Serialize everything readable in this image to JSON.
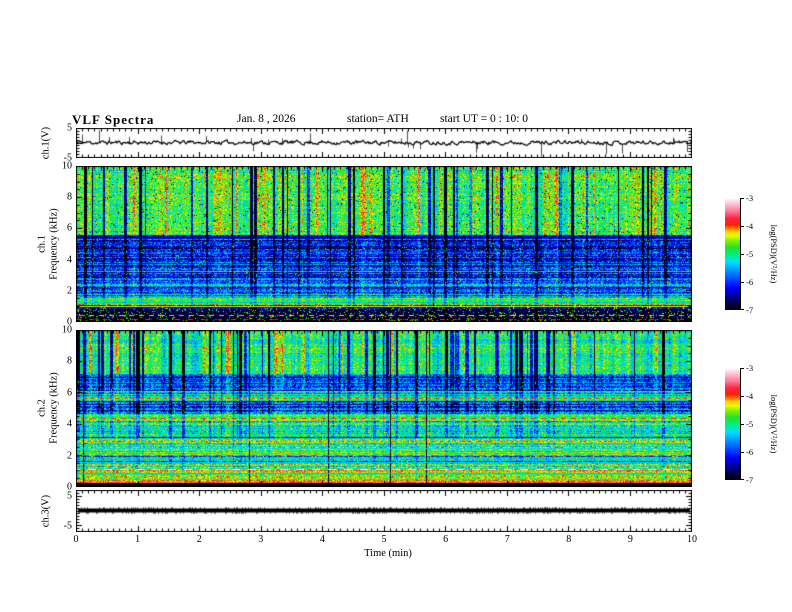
{
  "figure": {
    "title": "VLF  Spectra",
    "date": "Jan. 8 , 2026",
    "station": "station= ATH",
    "start_ut": "start UT =  0 : 10: 0"
  },
  "axes": {
    "x": {
      "label": "Time  (min)",
      "min": 0,
      "max": 10,
      "major_ticks": [
        "0",
        "1",
        "2",
        "3",
        "4",
        "5",
        "6",
        "7",
        "8",
        "9",
        "10"
      ],
      "minor_step": 0.1
    },
    "colorbar": {
      "label": "log(PSD)(V²/Hz)",
      "min": -7,
      "max": -3,
      "ticks": [
        {
          "v": -3,
          "t": "-3"
        },
        {
          "v": -4,
          "t": "-4"
        },
        {
          "v": -5,
          "t": "-5"
        },
        {
          "v": -6,
          "t": "-6"
        },
        {
          "v": -7,
          "t": "-7"
        }
      ]
    }
  },
  "colormap": {
    "stops": [
      {
        "t": 0.0,
        "c": "#000000"
      },
      {
        "t": 0.08,
        "c": "#000060"
      },
      {
        "t": 0.2,
        "c": "#0000ff"
      },
      {
        "t": 0.33,
        "c": "#0080ff"
      },
      {
        "t": 0.43,
        "c": "#00e0ff"
      },
      {
        "t": 0.5,
        "c": "#00f07a"
      },
      {
        "t": 0.56,
        "c": "#28e028"
      },
      {
        "t": 0.62,
        "c": "#88ee00"
      },
      {
        "t": 0.66,
        "c": "#e0ff00"
      },
      {
        "t": 0.7,
        "c": "#ffd000"
      },
      {
        "t": 0.73,
        "c": "#ff7700"
      },
      {
        "t": 0.76,
        "c": "#ff2200"
      },
      {
        "t": 0.82,
        "c": "#ff2244"
      },
      {
        "t": 0.88,
        "c": "#ff7799"
      },
      {
        "t": 0.95,
        "c": "#ffc4d4"
      },
      {
        "t": 1.0,
        "c": "#ffffff"
      }
    ]
  },
  "chart_data": [
    {
      "id": "ch1-waveform",
      "type": "line",
      "ylabel": "ch.1(V)",
      "ylim": [
        -5,
        5
      ],
      "yticklabels": [
        {
          "v": 5,
          "t": "5"
        },
        {
          "v": -5,
          "t": "-5"
        }
      ],
      "description": "broadband noisy voltage trace centered on 0 V with impulsive spikes reaching ±5 V across 0–10 min",
      "trace": {
        "seed": 11,
        "base_amp": 1.1,
        "spike_prob": 0.085,
        "spike_amp": 4.6,
        "color": "#000000"
      }
    },
    {
      "id": "ch1-spectrogram",
      "type": "heatmap",
      "ylabel_line1": "ch.1",
      "ylabel_line2": "Frequency  (kHz)",
      "ylim": [
        0,
        10
      ],
      "yticklabels": [
        {
          "v": 10,
          "t": "10"
        },
        {
          "v": 8,
          "t": "8"
        },
        {
          "v": 6,
          "t": "6"
        },
        {
          "v": 4,
          "t": "4"
        },
        {
          "v": 2,
          "t": "2"
        },
        {
          "v": 0,
          "t": "0"
        }
      ],
      "value_range": [
        -7,
        -3
      ],
      "units": "log(PSD)(V²/Hz)",
      "description": "5.6-10 kHz green (~-4.8) with dark-blue vertical dropouts; 2.7-5.3 kHz blue (~-6) with horizontal banding; 1-2.7 kHz cyan bands; below 0.9 kHz near-black with speckles",
      "texture": {
        "seed": 101,
        "stripes": {
          "density": 0.085,
          "width_max": 3,
          "dark_amp": 1.9,
          "bright_prob": 0.05,
          "bright_amp": 0.55
        },
        "dropout_prob": 0.007,
        "bands": [
          {
            "f0": 5.6,
            "f1": 10.0,
            "base": -4.75,
            "noise": 0.5,
            "stripe": 1.0,
            "row": 0.18,
            "speckle_p": 0.02,
            "speckle_v": -6.6
          },
          {
            "f0": 5.35,
            "f1": 5.6,
            "base": -6.3,
            "noise": 0.4,
            "stripe": 0.3,
            "row": 0.3
          },
          {
            "f0": 2.7,
            "f1": 5.35,
            "base": -6.05,
            "noise": 0.55,
            "stripe": 0.45,
            "row": 0.55,
            "speckle_p": 0.05,
            "speckle_v": -5.1
          },
          {
            "f0": 1.6,
            "f1": 2.7,
            "base": -5.45,
            "noise": 0.5,
            "stripe": 0.35,
            "row": 0.75,
            "speckle_p": 0.04,
            "speckle_v": -4.6
          },
          {
            "f0": 1.1,
            "f1": 1.6,
            "base": -5.05,
            "noise": 0.45,
            "stripe": 0.25,
            "row": 0.5
          },
          {
            "f0": 0.85,
            "f1": 1.1,
            "base": -6.2,
            "noise": 0.5,
            "stripe": 0.2,
            "row": 0.4,
            "speckle_p": 0.06,
            "speckle_v": -4.4
          },
          {
            "f0": 0.0,
            "f1": 0.85,
            "base": -6.85,
            "noise": 0.25,
            "stripe": 0.1,
            "row": 0.15,
            "speckle_p": 0.1,
            "speckle_v": -4.6
          }
        ],
        "lines": [
          {
            "f": 5.45,
            "v": -6.7,
            "th": 1,
            "dash": 0
          },
          {
            "f": 1.35,
            "v": -4.9,
            "th": 1,
            "dash": 0
          },
          {
            "f": 1.05,
            "v": -4.35,
            "th": 1,
            "dash": 0
          },
          {
            "f": 0.45,
            "v": -4.2,
            "th": 1,
            "dash": 5
          },
          {
            "f": 0.2,
            "v": -3.9,
            "th": 1,
            "dash": 7
          }
        ]
      }
    },
    {
      "id": "ch2-spectrogram",
      "type": "heatmap",
      "ylabel_line1": "ch.2",
      "ylabel_line2": "Frequency  (kHz)",
      "ylim": [
        0,
        10
      ],
      "yticklabels": [
        {
          "v": 10,
          "t": "10"
        },
        {
          "v": 8,
          "t": "8"
        },
        {
          "v": 6,
          "t": "6"
        },
        {
          "v": 4,
          "t": "4"
        },
        {
          "v": 2,
          "t": "2"
        },
        {
          "v": 0,
          "t": "0"
        }
      ],
      "value_range": [
        -7,
        -3
      ],
      "units": "log(PSD)(V²/Hz)",
      "description": "7-10 kHz cyan with dense dark-blue vertical stripes; 4.7-7 kHz alternating blue/cyan bands; red dashed line near 4.4 kHz; below 3 kHz green (~-4.7) with yellow/red horizontal lines near 2-3 kHz; red edge ~0.35 kHz and black base",
      "texture": {
        "seed": 202,
        "stripes": {
          "density": 0.1,
          "width_max": 4,
          "dark_amp": 1.8,
          "bright_prob": 0.05,
          "bright_amp": 0.5
        },
        "dropout_prob": 0.004,
        "bands": [
          {
            "f0": 7.2,
            "f1": 10.0,
            "base": -5.0,
            "noise": 0.5,
            "stripe": 1.1,
            "row": 0.2
          },
          {
            "f0": 6.1,
            "f1": 7.2,
            "base": -6.1,
            "noise": 0.5,
            "stripe": 0.6,
            "row": 0.55,
            "speckle_p": 0.05,
            "speckle_v": -5.0
          },
          {
            "f0": 5.5,
            "f1": 6.1,
            "base": -5.15,
            "noise": 0.45,
            "stripe": 0.4,
            "row": 0.45
          },
          {
            "f0": 4.65,
            "f1": 5.5,
            "base": -6.0,
            "noise": 0.55,
            "stripe": 0.5,
            "row": 0.55,
            "speckle_p": 0.05,
            "speckle_v": -5.0
          },
          {
            "f0": 4.2,
            "f1": 4.65,
            "base": -4.8,
            "noise": 0.4,
            "stripe": 0.3,
            "row": 0.4
          },
          {
            "f0": 3.15,
            "f1": 4.2,
            "base": -5.2,
            "noise": 0.5,
            "stripe": 0.35,
            "row": 0.55,
            "speckle_p": 0.04,
            "speckle_v": -4.5
          },
          {
            "f0": 0.45,
            "f1": 3.15,
            "base": -4.75,
            "noise": 0.45,
            "stripe": 0.2,
            "row": 0.55,
            "speckle_p": 0.05,
            "speckle_v": -4.3
          },
          {
            "f0": 0.28,
            "f1": 0.45,
            "base": -3.9,
            "noise": 0.4,
            "stripe": 0.1,
            "row": 0.3
          },
          {
            "f0": 0.0,
            "f1": 0.28,
            "base": -6.9,
            "noise": 0.2,
            "stripe": 0.05,
            "row": 0.1
          }
        ],
        "lines": [
          {
            "f": 5.65,
            "v": -3.95,
            "th": 1,
            "dash": 4
          },
          {
            "f": 4.4,
            "v": -3.75,
            "th": 1,
            "dash": 5
          },
          {
            "f": 3.05,
            "v": -4.15,
            "th": 2,
            "dash": 3
          },
          {
            "f": 2.5,
            "v": -5.3,
            "th": 1,
            "dash": 0
          },
          {
            "f": 2.05,
            "v": -3.7,
            "th": 1,
            "dash": 6
          },
          {
            "f": 1.6,
            "v": -5.3,
            "th": 1,
            "dash": 0
          },
          {
            "f": 1.15,
            "v": -3.1,
            "th": 1,
            "dash": 8
          },
          {
            "f": 0.9,
            "v": -5.4,
            "th": 1,
            "dash": 0
          },
          {
            "f": 0.12,
            "v": -6.9,
            "th": 2,
            "dash": 0
          }
        ]
      }
    },
    {
      "id": "ch3-waveform",
      "type": "line",
      "ylabel": "ch.3(V)",
      "ylim": [
        -7,
        7
      ],
      "yticklabels": [
        {
          "v": 5,
          "t": "5"
        },
        {
          "v": -5,
          "t": "-5"
        }
      ],
      "description": "flat thick trace at 0 V for the full 0–10 min interval (no signal on ch.3)",
      "trace": {
        "seed": 33,
        "flat": true,
        "value": 0,
        "thickness": 4,
        "color": "#000000"
      }
    }
  ]
}
